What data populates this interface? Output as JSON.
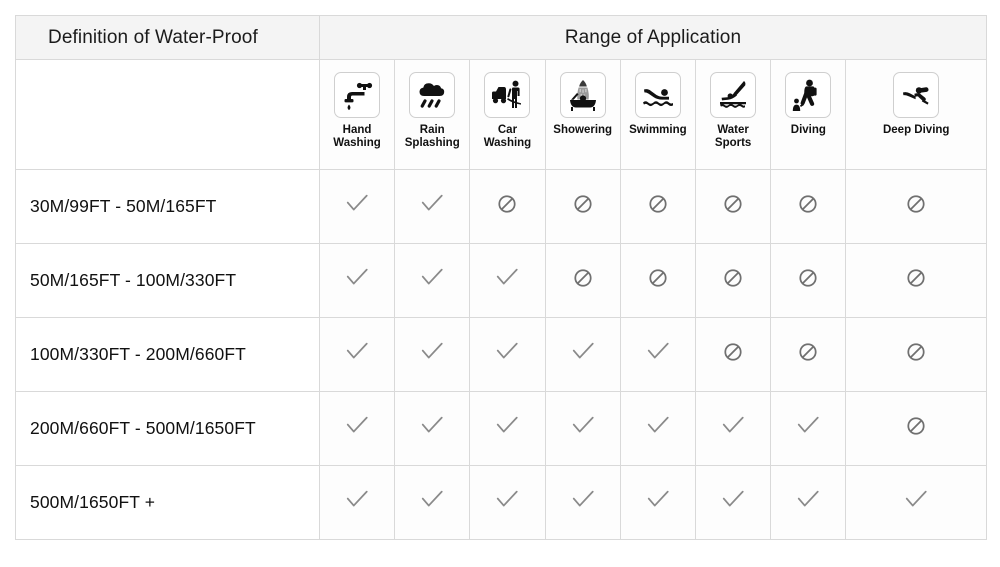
{
  "header": {
    "definition_title": "Definition of Water-Proof",
    "range_title": "Range of Application"
  },
  "columns": [
    {
      "icon": "faucet-hand-washing-icon",
      "label": "Hand\nWashing"
    },
    {
      "icon": "rain-cloud-icon",
      "label": "Rain\nSplashing"
    },
    {
      "icon": "car-washing-icon",
      "label": "Car\nWashing"
    },
    {
      "icon": "showering-bathtub-icon",
      "label": "Showering"
    },
    {
      "icon": "swimming-icon",
      "label": "Swimming"
    },
    {
      "icon": "water-sports-diving-board-icon",
      "label": "Water\nSports"
    },
    {
      "icon": "diving-icon",
      "label": "Diving"
    },
    {
      "icon": "deep-diving-scuba-icon",
      "label": "Deep Diving"
    }
  ],
  "rows": [
    {
      "depth": "30M/99FT   -   50M/165FT",
      "marks": [
        "check",
        "check",
        "no",
        "no",
        "no",
        "no",
        "no",
        "no"
      ]
    },
    {
      "depth": "50M/165FT   -   100M/330FT",
      "marks": [
        "check",
        "check",
        "check",
        "no",
        "no",
        "no",
        "no",
        "no"
      ]
    },
    {
      "depth": "100M/330FT   -   200M/660FT",
      "marks": [
        "check",
        "check",
        "check",
        "check",
        "check",
        "no",
        "no",
        "no"
      ]
    },
    {
      "depth": "200M/660FT   -   500M/1650FT",
      "marks": [
        "check",
        "check",
        "check",
        "check",
        "check",
        "check",
        "check",
        "no"
      ]
    },
    {
      "depth": "500M/1650FT  +",
      "marks": [
        "check",
        "check",
        "check",
        "check",
        "check",
        "check",
        "check",
        "check"
      ]
    }
  ],
  "marks_legend": {
    "check": "supported",
    "no": "not-supported"
  },
  "colors": {
    "header_bg": "#f4f4f4",
    "grid_line": "#d9d9d9",
    "text": "#111111",
    "mark_gray": "#8a8a8a",
    "icon_black": "#111111",
    "cell_bg": "#fdfdfd"
  }
}
